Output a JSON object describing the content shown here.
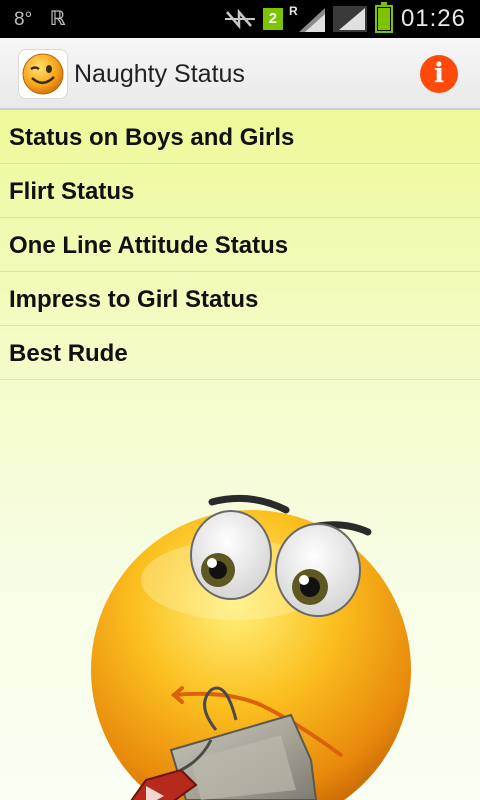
{
  "status_bar": {
    "left_number": "8°",
    "sim_number": "2",
    "roaming_label": "R",
    "time": "01:26",
    "icons": [
      "notification-icon",
      "mute-icon",
      "signal-icon",
      "battery-icon"
    ]
  },
  "action_bar": {
    "title": "Naughty Status",
    "info_label": "i",
    "icons": [
      "winking-smiley-app-icon",
      "info-icon"
    ],
    "colors": {
      "info": "#ff4a0a"
    }
  },
  "list": {
    "items": [
      {
        "label": "Status on Boys and Girls"
      },
      {
        "label": "Flirt Status"
      },
      {
        "label": "One Line Attitude Status"
      },
      {
        "label": "Impress to Girl Status"
      },
      {
        "label": "Best Rude"
      }
    ]
  },
  "illustration": {
    "icon": "angry-smiley-with-teabag-icon"
  }
}
